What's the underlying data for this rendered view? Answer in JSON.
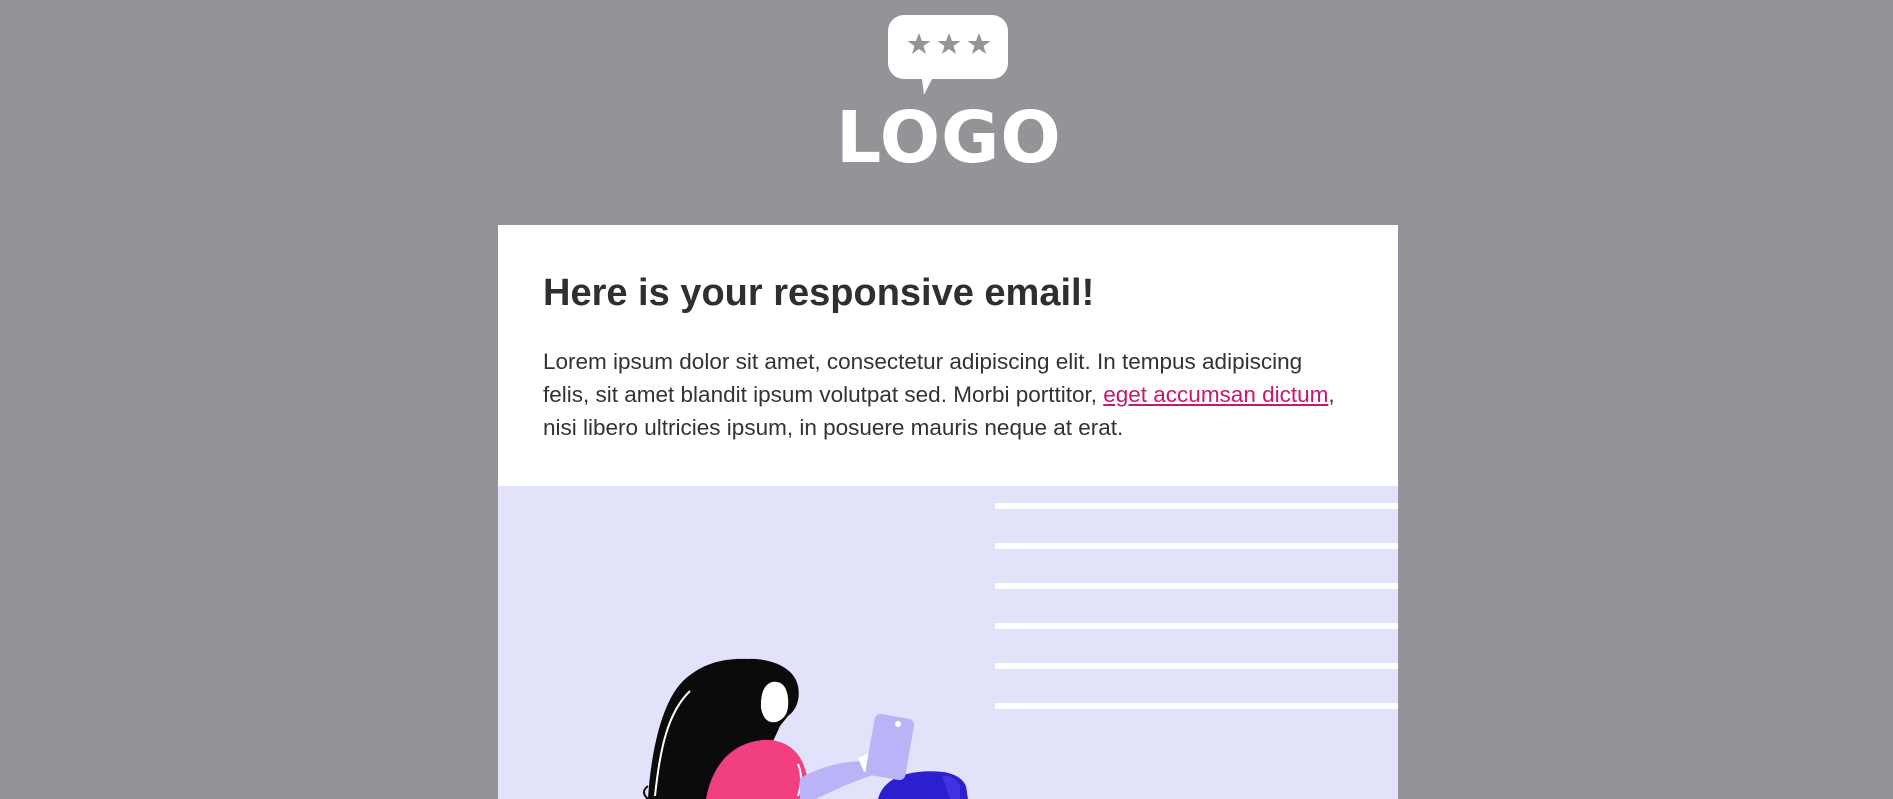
{
  "header": {
    "logo_text": "LOGO",
    "logo_icon": "speech-bubble-three-stars-icon"
  },
  "content": {
    "headline": "Here is your responsive email!",
    "paragraph_before_link": "Lorem ipsum dolor sit amet, consectetur adipiscing elit. In tempus adipiscing felis, sit amet blandit ipsum volutpat sed. Morbi porttitor, ",
    "link_text": "eget accumsan dictum",
    "paragraph_after_link": ", nisi libero ultricies ipsum, in posuere mauris neque at erat."
  },
  "hero": {
    "illustration": "woman-using-phone-illustration"
  },
  "colors": {
    "page_background": "#939398",
    "card_background": "#ffffff",
    "hero_background": "#e3e2fb",
    "link": "#c9176f",
    "text": "#333333",
    "accent_pink": "#f23f82",
    "accent_lavender": "#b9b3f7",
    "accent_blue": "#2d1fd0"
  }
}
